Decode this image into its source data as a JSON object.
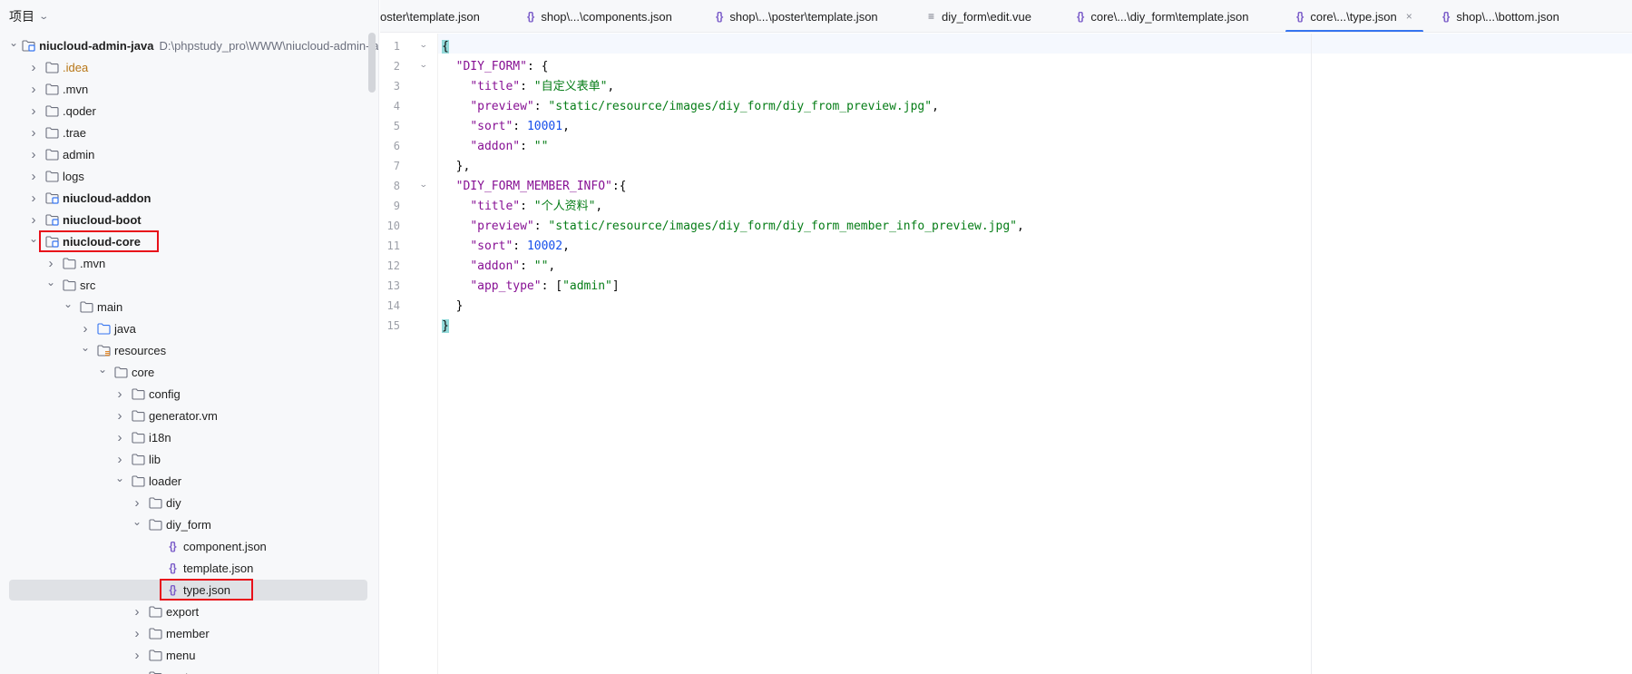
{
  "panel": {
    "title": "项目"
  },
  "tree": [
    {
      "depth": 0,
      "type": "module",
      "expanded": true,
      "label": "niucloud-admin-java",
      "bold": true,
      "hint": "D:\\phpstudy_pro\\WWW\\niucloud-admin-java"
    },
    {
      "depth": 1,
      "type": "folder",
      "expanded": false,
      "label": ".idea",
      "orange": true
    },
    {
      "depth": 1,
      "type": "folder",
      "expanded": false,
      "label": ".mvn"
    },
    {
      "depth": 1,
      "type": "folder",
      "expanded": false,
      "label": ".qoder"
    },
    {
      "depth": 1,
      "type": "folder",
      "expanded": false,
      "label": ".trae"
    },
    {
      "depth": 1,
      "type": "folder",
      "expanded": false,
      "label": "admin"
    },
    {
      "depth": 1,
      "type": "folder",
      "expanded": false,
      "label": "logs"
    },
    {
      "depth": 1,
      "type": "module",
      "expanded": false,
      "label": "niucloud-addon",
      "bold": true
    },
    {
      "depth": 1,
      "type": "module",
      "expanded": false,
      "label": "niucloud-boot",
      "bold": true
    },
    {
      "depth": 1,
      "type": "module",
      "expanded": true,
      "label": "niucloud-core",
      "bold": true,
      "boxed": true
    },
    {
      "depth": 2,
      "type": "folder",
      "expanded": false,
      "label": ".mvn"
    },
    {
      "depth": 2,
      "type": "folder",
      "expanded": true,
      "label": "src"
    },
    {
      "depth": 3,
      "type": "folder",
      "expanded": true,
      "label": "main"
    },
    {
      "depth": 4,
      "type": "folder-src",
      "expanded": false,
      "label": "java"
    },
    {
      "depth": 4,
      "type": "folder-res",
      "expanded": true,
      "label": "resources"
    },
    {
      "depth": 5,
      "type": "folder",
      "expanded": true,
      "label": "core"
    },
    {
      "depth": 6,
      "type": "folder",
      "expanded": false,
      "label": "config"
    },
    {
      "depth": 6,
      "type": "folder",
      "expanded": false,
      "label": "generator.vm"
    },
    {
      "depth": 6,
      "type": "folder",
      "expanded": false,
      "label": "i18n"
    },
    {
      "depth": 6,
      "type": "folder",
      "expanded": false,
      "label": "lib"
    },
    {
      "depth": 6,
      "type": "folder",
      "expanded": true,
      "label": "loader"
    },
    {
      "depth": 7,
      "type": "folder",
      "expanded": false,
      "label": "diy"
    },
    {
      "depth": 7,
      "type": "folder",
      "expanded": true,
      "label": "diy_form"
    },
    {
      "depth": 8,
      "type": "json",
      "label": "component.json"
    },
    {
      "depth": 8,
      "type": "json",
      "label": "template.json"
    },
    {
      "depth": 8,
      "type": "json",
      "label": "type.json",
      "selected": true,
      "boxed": true
    },
    {
      "depth": 7,
      "type": "folder",
      "expanded": false,
      "label": "export"
    },
    {
      "depth": 7,
      "type": "folder",
      "expanded": false,
      "label": "member"
    },
    {
      "depth": 7,
      "type": "folder",
      "expanded": false,
      "label": "menu"
    },
    {
      "depth": 7,
      "type": "folder",
      "expanded": false,
      "label": "poster"
    }
  ],
  "tabs": [
    {
      "label": "oster\\template.json",
      "icon": "json-icon",
      "partial": true
    },
    {
      "label": "shop\\...\\components.json",
      "icon": "json-icon"
    },
    {
      "label": "shop\\...\\poster\\template.json",
      "icon": "json-icon"
    },
    {
      "label": "diy_form\\edit.vue",
      "icon": "vue-file-icon"
    },
    {
      "label": "core\\...\\diy_form\\template.json",
      "icon": "json-icon"
    },
    {
      "label": "core\\...\\type.json",
      "icon": "json-icon",
      "active": true,
      "close": "×"
    },
    {
      "label": "shop\\...\\bottom.json",
      "icon": "json-icon"
    }
  ],
  "editor": {
    "foldable_lines": [
      1,
      2,
      8
    ],
    "lines": [
      [
        [
          "brace",
          "{"
        ]
      ],
      [
        [
          "p",
          "  "
        ],
        [
          "k",
          "\"DIY_FORM\""
        ],
        [
          "p",
          ": {"
        ]
      ],
      [
        [
          "p",
          "    "
        ],
        [
          "k",
          "\"title\""
        ],
        [
          "p",
          ": "
        ],
        [
          "s",
          "\"自定义表单\""
        ],
        [
          "p",
          ","
        ]
      ],
      [
        [
          "p",
          "    "
        ],
        [
          "k",
          "\"preview\""
        ],
        [
          "p",
          ": "
        ],
        [
          "s",
          "\"static/resource/images/diy_form/diy_from_preview.jpg\""
        ],
        [
          "p",
          ","
        ]
      ],
      [
        [
          "p",
          "    "
        ],
        [
          "k",
          "\"sort\""
        ],
        [
          "p",
          ": "
        ],
        [
          "n",
          "10001"
        ],
        [
          "p",
          ","
        ]
      ],
      [
        [
          "p",
          "    "
        ],
        [
          "k",
          "\"addon\""
        ],
        [
          "p",
          ": "
        ],
        [
          "s",
          "\"\""
        ]
      ],
      [
        [
          "p",
          "  },"
        ]
      ],
      [
        [
          "p",
          "  "
        ],
        [
          "k",
          "\"DIY_FORM_MEMBER_INFO\""
        ],
        [
          "p",
          ":{"
        ]
      ],
      [
        [
          "p",
          "    "
        ],
        [
          "k",
          "\"title\""
        ],
        [
          "p",
          ": "
        ],
        [
          "s",
          "\"个人资料\""
        ],
        [
          "p",
          ","
        ]
      ],
      [
        [
          "p",
          "    "
        ],
        [
          "k",
          "\"preview\""
        ],
        [
          "p",
          ": "
        ],
        [
          "s",
          "\"static/resource/images/diy_form/diy_form_member_info_preview.jpg\""
        ],
        [
          "p",
          ","
        ]
      ],
      [
        [
          "p",
          "    "
        ],
        [
          "k",
          "\"sort\""
        ],
        [
          "p",
          ": "
        ],
        [
          "n",
          "10002"
        ],
        [
          "p",
          ","
        ]
      ],
      [
        [
          "p",
          "    "
        ],
        [
          "k",
          "\"addon\""
        ],
        [
          "p",
          ": "
        ],
        [
          "s",
          "\"\""
        ],
        [
          "p",
          ","
        ]
      ],
      [
        [
          "p",
          "    "
        ],
        [
          "k",
          "\"app_type\""
        ],
        [
          "p",
          ": ["
        ],
        [
          "s",
          "\"admin\""
        ],
        [
          "p",
          "]"
        ]
      ],
      [
        [
          "p",
          "  }"
        ]
      ],
      [
        [
          "brace",
          "}"
        ]
      ]
    ]
  },
  "colors": {
    "accent": "#3574f0",
    "highlight_box": "#e8101a",
    "selection": "#dfe1e5"
  }
}
